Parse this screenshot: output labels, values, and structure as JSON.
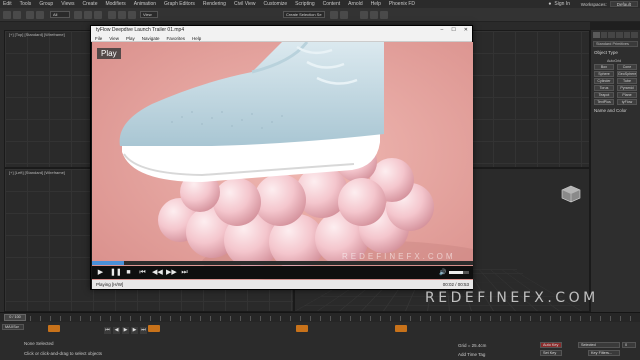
{
  "max": {
    "menu": [
      "Edit",
      "Tools",
      "Group",
      "Views",
      "Create",
      "Modifiers",
      "Animation",
      "Graph Editors",
      "Rendering",
      "Civil View",
      "Customize",
      "Scripting",
      "Content",
      "Arnold",
      "Help",
      "Phoenix FD"
    ],
    "sign_in": "Sign In",
    "workspace_label": "Workspaces:",
    "workspace_value": "Default",
    "toolbar_field_a": "All",
    "toolbar_field_b": "View",
    "toolbar_field_c": "Create Selection Se",
    "viewports": {
      "top": "[+] [Top] [Standard] [Wireframe]",
      "left": "[+] [Left] [Standard] [Wireframe]"
    },
    "command_panel": {
      "dropdown": "Standard Primitives",
      "object_type": "Object Type",
      "autogrid": "AutoGrid",
      "buttons": [
        "Box",
        "Cone",
        "Sphere",
        "GeoSphere",
        "Cylinder",
        "Tube",
        "Torus",
        "Pyramid",
        "Teapot",
        "Plane",
        "TextPlus",
        "tyFlow"
      ],
      "name_and_color": "Name and Color"
    },
    "timeline": {
      "slider": "0 / 100"
    },
    "status": {
      "selection": "None Selected",
      "prompt": "Click or click-and-drag to select objects",
      "maxscript": "MAXScr",
      "grid": "Grid = 25.4cm",
      "add_time_tag": "Add Time Tag",
      "auto_key": "Auto Key",
      "set_key": "Set Key",
      "selected": "Selected",
      "key_filters": "Key Filters...",
      "frame": "0"
    }
  },
  "player": {
    "title": "tyFlow Deepdive Launch Trailer 01.mp4",
    "menu": [
      "File",
      "View",
      "Play",
      "Navigate",
      "Favorites",
      "Help"
    ],
    "badge": "Play",
    "subtitle_watermark": "REDEFINEFX.COM",
    "status_left": "Playing [H/W]",
    "status_right": "00:02 / 00:53",
    "progress": 0.085,
    "volume": 0.7,
    "controls": [
      "▶",
      "❚❚",
      "■",
      "⏮",
      "◀◀",
      "▶▶",
      "⏭"
    ]
  },
  "watermark": "REDEFINEFX.COM",
  "colors": {
    "accent": "#c8721a",
    "video_bg": "#e9aca7",
    "shoe": "#c7dbe4"
  }
}
